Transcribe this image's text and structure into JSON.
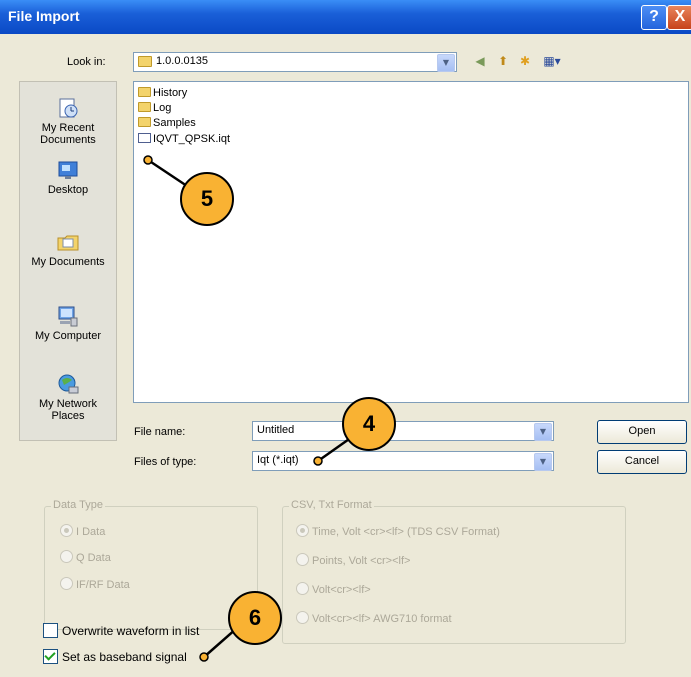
{
  "window": {
    "title": "File Import",
    "help_label": "?",
    "close_label": "X"
  },
  "lookin": {
    "label": "Look in:",
    "value": "1.0.0.0135"
  },
  "places": [
    {
      "label": "My Recent\nDocuments",
      "icon": "recent-documents-icon"
    },
    {
      "label": "Desktop",
      "icon": "desktop-icon"
    },
    {
      "label": "My Documents",
      "icon": "my-documents-icon"
    },
    {
      "label": "My Computer",
      "icon": "my-computer-icon"
    },
    {
      "label": "My Network\nPlaces",
      "icon": "network-places-icon"
    }
  ],
  "files": [
    {
      "name": "History",
      "type": "folder"
    },
    {
      "name": "Log",
      "type": "folder"
    },
    {
      "name": "Samples",
      "type": "folder"
    },
    {
      "name": "IQVT_QPSK.iqt",
      "type": "file"
    }
  ],
  "filename": {
    "label": "File name:",
    "value": "Untitled"
  },
  "filetype": {
    "label": "Files of type:",
    "value": "Iqt (*.iqt)"
  },
  "buttons": {
    "open": "Open",
    "cancel": "Cancel"
  },
  "data_type": {
    "title": "Data Type",
    "options": [
      "I Data",
      "Q Data",
      "IF/RF Data"
    ],
    "selected": 0
  },
  "csv_format": {
    "title": "CSV, Txt Format",
    "options": [
      "Time, Volt <cr><lf> (TDS CSV Format)",
      "Points, Volt <cr><lf>",
      "Volt<cr><lf>",
      "Volt<cr><lf> AWG710 format"
    ],
    "selected": 0
  },
  "checks": {
    "overwrite": {
      "label": "Overwrite waveform in list",
      "checked": false
    },
    "baseband": {
      "label": "Set as baseband signal",
      "checked": true
    }
  },
  "callouts": [
    "5",
    "4",
    "6"
  ],
  "colors": {
    "titlebar": "#0a49c5",
    "dialog_bg": "#ece9d8",
    "callout": "#f9b233"
  }
}
